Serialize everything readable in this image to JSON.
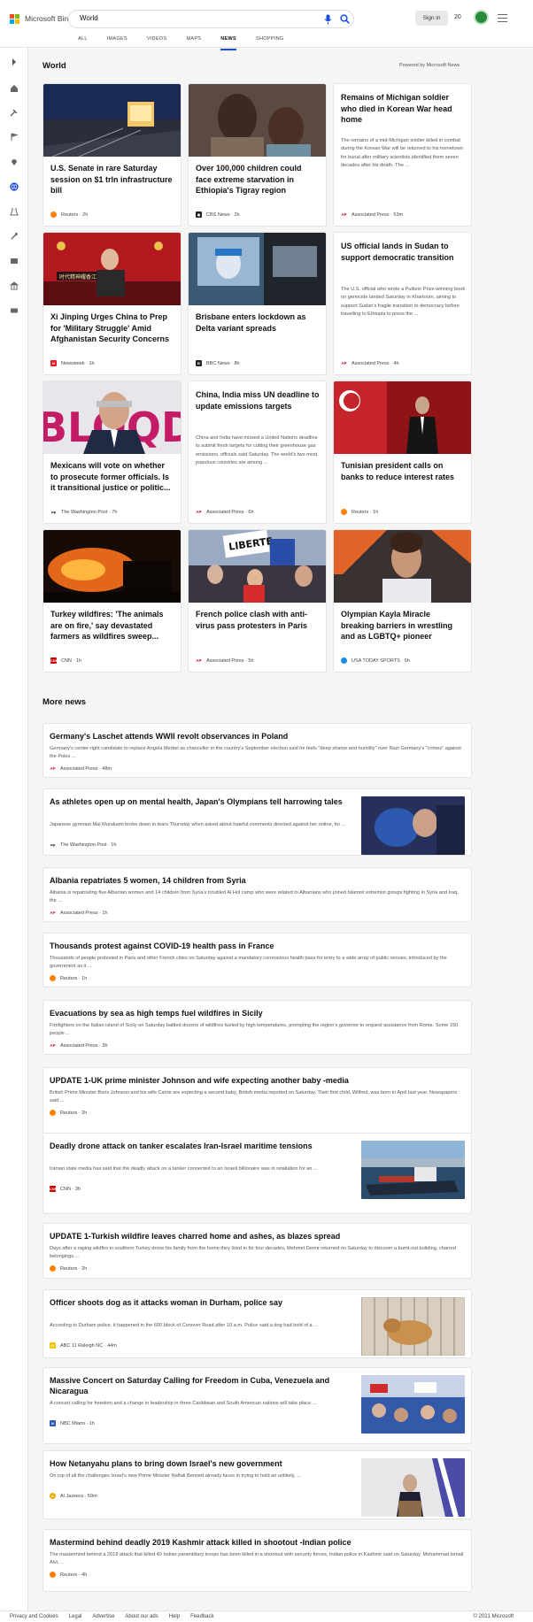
{
  "header": {
    "brand": "Microsoft Bing",
    "query": "World",
    "signin": "Sign in",
    "points": "20",
    "tabs": [
      "ALL",
      "IMAGES",
      "VIDEOS",
      "MAPS",
      "NEWS",
      "SHOPPING"
    ],
    "active_tab": "NEWS"
  },
  "section_title": "World",
  "powered_by": "Powered by Microsoft News",
  "cards": [
    {
      "title": "U.S. Senate in rare Saturday session on $1 trln infrastructure bill",
      "source": "Reuters",
      "time": "2h",
      "icon": "reuters-icon"
    },
    {
      "title": "Over 100,000 children could face extreme starvation in Ethiopia's Tigray region",
      "source": "CBS News",
      "time": "2h",
      "icon": "cbs-icon"
    },
    {
      "title": "Remains of Michigan soldier who died in Korean War head home",
      "desc": "The remains of a mid-Michigan soldier killed in combat during the Korean War will be returned to his hometown for burial after military scientists identified them seven decades after his death. The ...",
      "source": "Associated Press",
      "time": "53m",
      "icon": "ap-icon"
    },
    {
      "title": "Xi Jinping Urges China to Prep for 'Military Struggle' Amid Afghanistan Security Concerns",
      "source": "Newsweek",
      "time": "1h",
      "icon": "newsweek-icon"
    },
    {
      "title": "Brisbane enters lockdown as Delta variant spreads",
      "source": "BBC News",
      "time": "8h",
      "icon": "bbc-icon"
    },
    {
      "title": "US official lands in Sudan to support democratic transition",
      "desc": "The U.S. official who wrote a Pulitzer Prize-winning book on genocide landed Saturday in Khartoum, aiming to support Sudan's fragile transition to democracy before travelling to Ethiopia to press the ...",
      "source": "Associated Press",
      "time": "4h",
      "icon": "ap-icon"
    },
    {
      "title": "Mexicans will vote on whether to prosecute former officials. Is it transitional justice or politic...",
      "source": "The Washington Post",
      "time": "7h",
      "icon": "wapo-icon"
    },
    {
      "title": "China, India miss UN deadline to update emissions targets",
      "desc": "China and India have missed a United Nations deadline to submit fresh targets for cutting their greenhouse gas emissions, officials said Saturday. The world's two most populous countries are among ...",
      "source": "Associated Press",
      "time": "6h",
      "icon": "ap-icon"
    },
    {
      "title": "Tunisian president calls on banks to reduce interest rates",
      "source": "Reuters",
      "time": "1h",
      "icon": "reuters-icon"
    },
    {
      "title": "Turkey wildfires: 'The animals are on fire,' say devastated farmers as wildfires sweep...",
      "source": "CNN",
      "time": "1h",
      "icon": "cnn-icon"
    },
    {
      "title": "French police clash with anti-virus pass protesters in Paris",
      "source": "Associated Press",
      "time": "5h",
      "icon": "ap-icon"
    },
    {
      "title": "Olympian Kayla Miracle breaking barriers in wrestling and as LGBTQ+ pioneer",
      "source": "USA TODAY SPORTS",
      "time": "6h",
      "icon": "usatoday-icon"
    }
  ],
  "more_news_title": "More news",
  "more_news": [
    {
      "title": "Germany's Laschet attends WWII revolt observances in Poland",
      "desc": "Germany's center-right candidate to replace Angela Merkel as chancellor in the country's September election said he feels \"deep shame and humility\" over Nazi Germany's \"crimes\" against the Poles ...",
      "source": "Associated Press",
      "time": "48m"
    },
    {
      "title": "As athletes open up on mental health, Japan's Olympians tell harrowing tales",
      "desc": "Japanese gymnast Mai Murakami broke down in tears Thursday when asked about hateful comments directed against her online, for ...",
      "source": "The Washington Post",
      "time": "1h"
    },
    {
      "title": "Albania repatriates 5 women, 14 children from Syria",
      "desc": "Albania is repatriating five Albanian women and 14 children from Syria's troubled Al Hol camp who were related to Albanians who joined Islamist extremist groups fighting in Syria and Iraq, the ...",
      "source": "Associated Press",
      "time": "1h"
    },
    {
      "title": "Thousands protest against COVID-19 health pass in France",
      "desc": "Thousands of people protested in Paris and other French cities on Saturday against a mandatory coronavirus health pass for entry to a wide array of public venues, introduced by the government as it ...",
      "source": "Reuters",
      "time": "1h"
    },
    {
      "title": "Evacuations by sea as high temps fuel wildfires in Sicily",
      "desc": "Firefighters on the Italian island of Sicily on Saturday battled dozens of wildfires fueled by high temperatures, prompting the region's governor to request assistance from Rome. Some 150 people ...",
      "source": "Associated Press",
      "time": "3h"
    },
    {
      "title": "UPDATE 1-UK prime minister Johnson and wife expecting another baby -media",
      "desc": "British Prime Minister Boris Johnson and his wife Carrie are expecting a second baby, British media reported on Saturday. Their first child, Wilfred, was born in April last year. Newspapers said ...",
      "source": "Reuters",
      "time": "2h"
    },
    {
      "title": "Deadly drone attack on tanker escalates Iran-Israel maritime tensions",
      "desc": "Iranian state media has said that the deadly attack on a tanker connected to an Israeli billionaire was in retaliation for an ...",
      "source": "CNN",
      "time": "3h"
    },
    {
      "title": "UPDATE 1-Turkish wildfire leaves charred home and ashes, as blazes spread",
      "desc": "Days after a raging wildfire in southern Turkey drove his family from the home they lived in for four decades, Mehmet Demir returned on Saturday to discover a burnt-out building, charred belongings ...",
      "source": "Reuters",
      "time": "2h"
    },
    {
      "title": "Officer shoots dog as it attacks woman in Durham, police say",
      "desc": "According to Durham police, it happened in the 600 block of Conover Road after 10 a.m. Police said a dog had hold of a ...",
      "source": "ABC 11 Raleigh NC",
      "time": "44m"
    },
    {
      "title": "Massive Concert on Saturday Calling for Freedom in Cuba, Venezuela and Nicaragua",
      "desc": "A concert calling for freedom and a change in leadership in three Caribbean and South American nations will take place ...",
      "source": "NBC Miami",
      "time": "1h"
    },
    {
      "title": "How Netanyahu plans to bring down Israel's new government",
      "desc": "On top of all the challenges Israel's new Prime Minister Naftali Bennett already faces in trying to hold an unlikely, ...",
      "source": "Al Jazeera",
      "time": "59m"
    },
    {
      "title": "Mastermind behind deadly 2019 Kashmir attack killed in shootout -Indian police",
      "desc": "The mastermind behind a 2019 attack that killed 40 Indian paramilitary troops has been killed in a shootout with security forces, Indian police in Kashmir said on Saturday. Mohammad Ismail Alvi, ...",
      "source": "Reuters",
      "time": "4h"
    }
  ],
  "image_text": {
    "xi_banner": "时代精神耀香江",
    "mexico_sign": "BLOQDE",
    "paris_sign": "LIBERTE"
  },
  "footer": {
    "links": [
      "Privacy and Cookies",
      "Legal",
      "Advertise",
      "About our ads",
      "Help",
      "Feedback"
    ],
    "copyright": "© 2021 Microsoft"
  },
  "colors": {
    "accent": "#174ae4",
    "bing_green": "#2a8b3a",
    "ap": "#c8102e",
    "cnn": "#cc0000",
    "reuters": "#ff8000"
  }
}
